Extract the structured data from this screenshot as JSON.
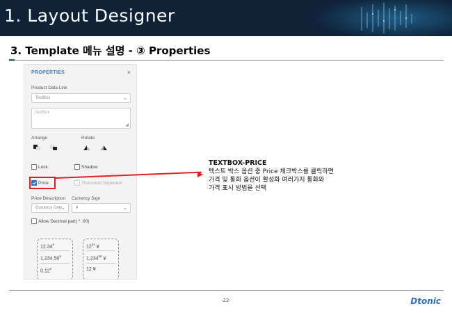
{
  "header": {
    "title": "1. Layout Designer"
  },
  "section": {
    "title": "3.  Template 메뉴 설명 - ③ Properties"
  },
  "panel": {
    "title": "PROPERTIES",
    "close_label": "×",
    "product_data_link_label": "Product Data Link",
    "product_data_link_value": "TextBox",
    "textarea_value": "TextBox",
    "arrange_label": "Arrange",
    "rotate_label": "Rotate",
    "lock_label": "Lock",
    "shadow_label": "Shadow",
    "price_label": "Price",
    "price_checked": true,
    "thousand_separator_label": "Thousand Seperator",
    "price_description_label": "Price Description",
    "price_description_value": "Currency Only",
    "currency_sign_label": "Currency Sign",
    "currency_sign_value": "¥",
    "allow_decimal_label": "Allow Decimal part( * .00)",
    "format_left": [
      "12.34",
      "1,234.56",
      "0.12"
    ],
    "format_left_sign": "¥",
    "format_right": [
      {
        "int": "12",
        "dec": "34",
        "sign": "¥"
      },
      {
        "int": "1,234",
        "dec": "56",
        "sign": "¥"
      },
      {
        "int": "12",
        "dec": "",
        "sign": "¥"
      }
    ]
  },
  "callout": {
    "title": "TEXTBOX-PRICE",
    "line1": "텍스트 박스 옵션 중 Price 체크박스를 클릭하면",
    "line2": "가격 및 통화 옵션이 활성화 여러가지 통화와",
    "line3": "가격 표시 방법을 선택"
  },
  "footer": {
    "page": "-22-",
    "logo": "Dtonic"
  },
  "colors": {
    "header_bg": "#0f2338",
    "accent_blue": "#2f74c0",
    "highlight_red": "#e02020",
    "logo_blue": "#2a6fb8"
  }
}
